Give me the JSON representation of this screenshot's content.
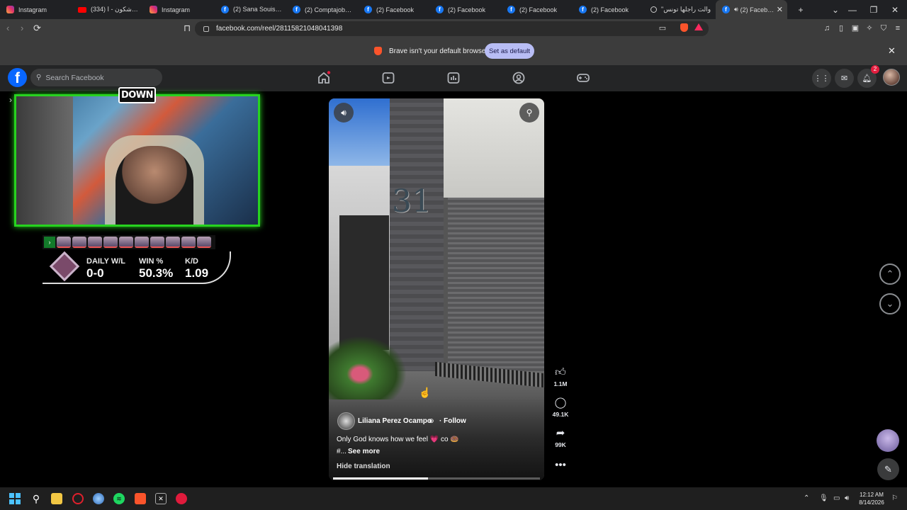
{
  "browser": {
    "tabs": [
      {
        "title": "Instagram",
        "icon": "instagram-icon",
        "kind": "ig"
      },
      {
        "title": "(334) طلع شكون - ا",
        "icon": "youtube-icon",
        "kind": "yt"
      },
      {
        "title": "Instagram",
        "icon": "instagram-icon",
        "kind": "ig"
      },
      {
        "title": "(2) Sana Souissi - و",
        "icon": "facebook-icon",
        "kind": "fb"
      },
      {
        "title": "(2) Comptajobs. tr",
        "icon": "facebook-icon",
        "kind": "fb"
      },
      {
        "title": "(2) Facebook",
        "icon": "facebook-icon",
        "kind": "fb"
      },
      {
        "title": "(2) Facebook",
        "icon": "facebook-icon",
        "kind": "fb"
      },
      {
        "title": "(2) Facebook",
        "icon": "facebook-icon",
        "kind": "fb"
      },
      {
        "title": "(2) Facebook",
        "icon": "facebook-icon",
        "kind": "fb"
      },
      {
        "title": "\"والت راجلها تونس",
        "icon": "globe-icon",
        "kind": "gen"
      },
      {
        "title": "(2) Facebook",
        "icon": "facebook-icon",
        "kind": "fb",
        "active": true
      }
    ],
    "new_tab": "+",
    "url": "facebook.com/reel/281158210480413​98"
  },
  "infobar": {
    "message": "Brave isn't your default browser",
    "button": "Set as default",
    "close": "✕"
  },
  "facebook": {
    "search_placeholder": "Search Facebook",
    "notification_count": "2"
  },
  "overlay": {
    "logo_text": "DOWN",
    "stats": {
      "daily_label": "DAILY W/L",
      "daily_value": "0-0",
      "win_label": "WIN %",
      "win_value": "50.3%",
      "kd_label": "K/D",
      "kd_value": "1.09"
    }
  },
  "reel": {
    "building_number": "31",
    "author": "Liliana Perez Ocampo",
    "follow": "· Follow",
    "caption": "Only God knows how we feel 💗 co 🍩",
    "hashtags": "#...",
    "see_more": "See more",
    "hide_translation": "Hide translation",
    "progress": 0.46,
    "likes": "1.1M",
    "comments": "49.1K",
    "shares": "99K"
  },
  "taskbar": {
    "time": "12:12 AM",
    "date": "8/14/2026"
  }
}
